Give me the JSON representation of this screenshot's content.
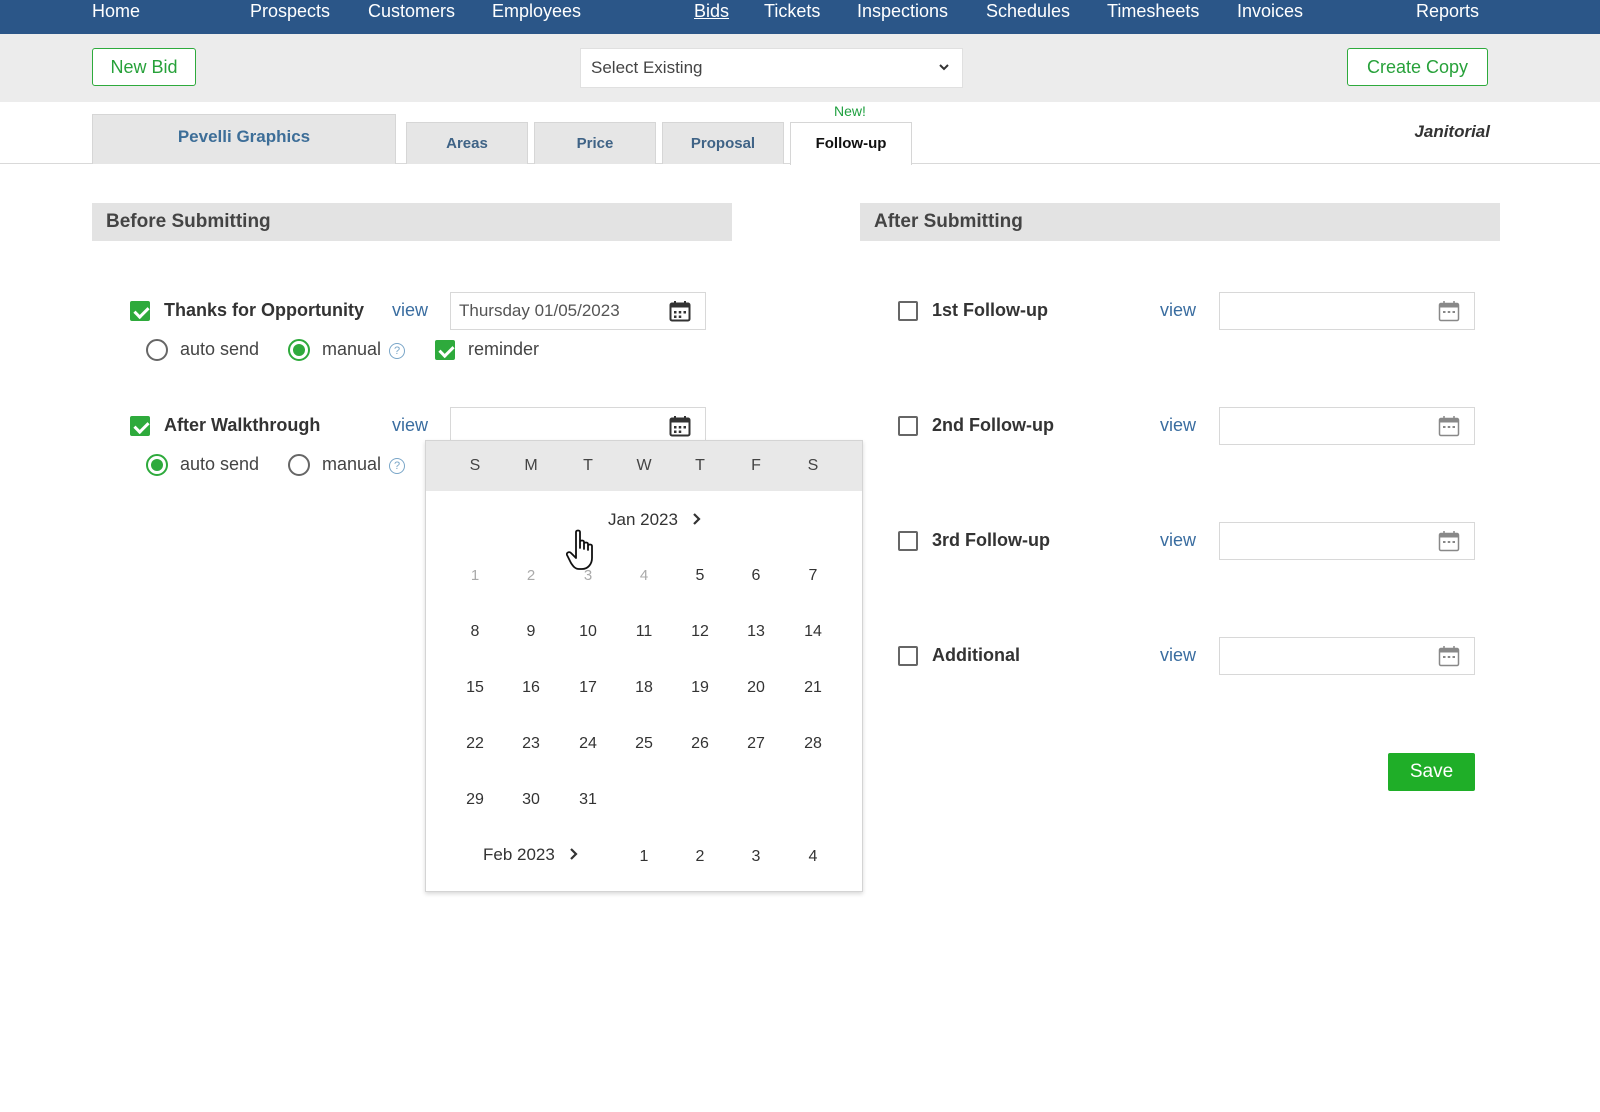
{
  "nav": {
    "items": [
      {
        "label": "Home"
      },
      {
        "label": "Prospects"
      },
      {
        "label": "Customers"
      },
      {
        "label": "Employees"
      },
      {
        "label": "Bids",
        "active": true
      },
      {
        "label": "Tickets"
      },
      {
        "label": "Inspections"
      },
      {
        "label": "Schedules"
      },
      {
        "label": "Timesheets"
      },
      {
        "label": "Invoices"
      },
      {
        "label": "Reports"
      }
    ]
  },
  "toolbar": {
    "new_bid_label": "New Bid",
    "select_existing": "Select Existing",
    "create_copy_label": "Create Copy"
  },
  "tabs": {
    "customer": "Pevelli Graphics",
    "items": [
      {
        "label": "Areas"
      },
      {
        "label": "Price"
      },
      {
        "label": "Proposal"
      },
      {
        "label": "Follow-up",
        "active": true
      }
    ],
    "new_badge": "New!",
    "category": "Janitorial"
  },
  "before": {
    "title": "Before Submitting",
    "items": [
      {
        "label": "Thanks for Opportunity",
        "checked": true,
        "view": "view",
        "date": "Thursday 01/05/2023",
        "auto_send_label": "auto send",
        "manual_label": "manual",
        "mode": "manual",
        "reminder_label": "reminder",
        "reminder": true
      },
      {
        "label": "After Walkthrough",
        "checked": true,
        "view": "view",
        "date": "",
        "auto_send_label": "auto send",
        "manual_label": "manual",
        "mode": "auto send"
      }
    ],
    "help": "?"
  },
  "after": {
    "title": "After Submitting",
    "items": [
      {
        "label": "1st Follow-up",
        "checked": false,
        "view": "view",
        "date": ""
      },
      {
        "label": "2nd Follow-up",
        "checked": false,
        "view": "view",
        "date": ""
      },
      {
        "label": "3rd Follow-up",
        "checked": false,
        "view": "view",
        "date": ""
      },
      {
        "label": "Additional",
        "checked": false,
        "view": "view",
        "date": ""
      }
    ]
  },
  "calendar": {
    "weekdays": [
      "S",
      "M",
      "T",
      "W",
      "T",
      "F",
      "S"
    ],
    "month1": "Jan 2023",
    "month1_week1": [
      "1",
      "2",
      "3",
      "4",
      "5",
      "6",
      "7"
    ],
    "month1_weeks": [
      [
        "8",
        "9",
        "10",
        "11",
        "12",
        "13",
        "14"
      ],
      [
        "15",
        "16",
        "17",
        "18",
        "19",
        "20",
        "21"
      ],
      [
        "22",
        "23",
        "24",
        "25",
        "26",
        "27",
        "28"
      ],
      [
        "29",
        "30",
        "31"
      ]
    ],
    "month2": "Feb 2023",
    "month2_days": [
      "1",
      "2",
      "3",
      "4"
    ]
  },
  "save_label": "Save",
  "colors": {
    "nav_bg": "#2b5688",
    "accent_green": "#2eaa3c",
    "save_green": "#1fae28",
    "link_blue": "#3a6da0"
  }
}
